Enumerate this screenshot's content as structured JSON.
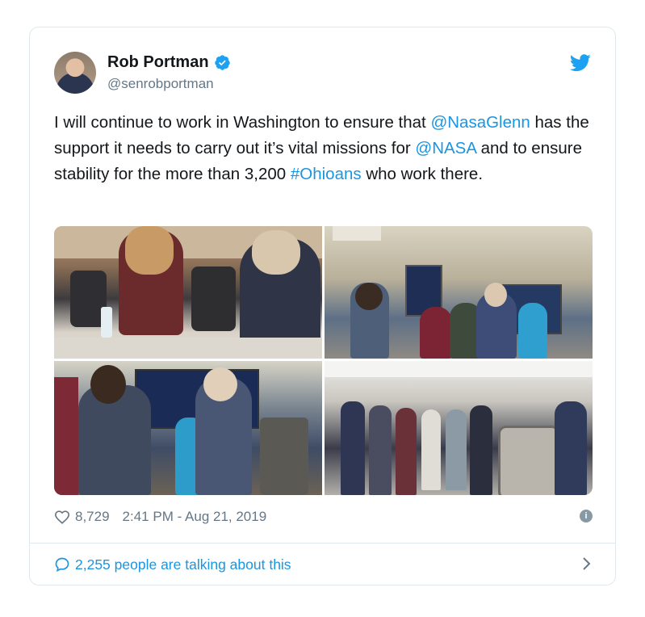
{
  "tweet": {
    "author_name": "Rob Portman",
    "author_handle": "@senrobportman",
    "verified": true,
    "text_parts": [
      {
        "text": "I will continue to work in Washington to ensure that ",
        "type": "plain"
      },
      {
        "text": "@NasaGlenn",
        "type": "link"
      },
      {
        "text": " has the support it needs to carry out it’s vital missions for ",
        "type": "plain"
      },
      {
        "text": "@NASA",
        "type": "link"
      },
      {
        "text": " and to ensure stability for the more than 3,200 ",
        "type": "plain"
      },
      {
        "text": "#Ohioans",
        "type": "link"
      },
      {
        "text": " who work there.",
        "type": "plain"
      }
    ],
    "likes": "8,729",
    "timestamp": "2:41 PM - Aug 21, 2019",
    "conversation": "2,255 people are talking about this"
  },
  "icons": {
    "brand": "twitter-bird-icon",
    "verified": "verified-badge-icon",
    "like": "heart-icon",
    "info": "info-icon",
    "reply": "speech-bubble-icon",
    "chevron": "chevron-right-icon"
  },
  "colors": {
    "link": "#1b95e0",
    "muted": "#657786",
    "text": "#14171a",
    "border": "#e1e8ed"
  }
}
